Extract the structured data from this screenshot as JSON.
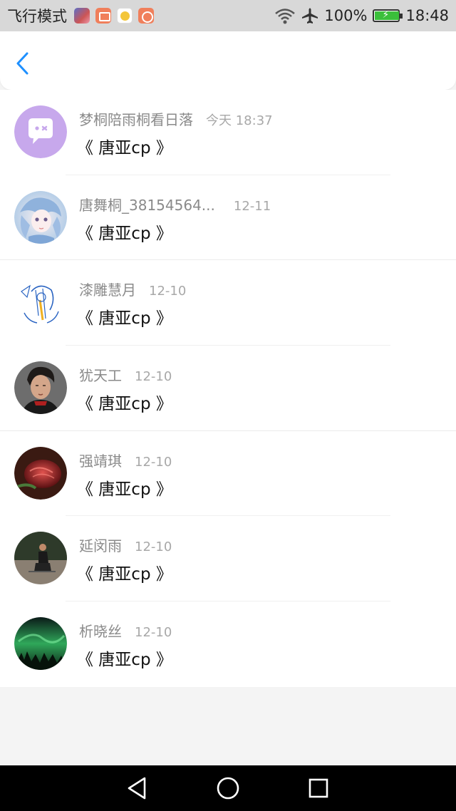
{
  "status_bar": {
    "mode_label": "飞行模式",
    "battery_text": "100%",
    "time": "18:48",
    "icons": [
      "app-icon-1",
      "app-icon-2",
      "app-icon-3",
      "app-icon-4",
      "wifi-icon",
      "airplane-icon",
      "battery-icon"
    ]
  },
  "header": {
    "back_icon": "chevron-left-icon"
  },
  "messages": [
    {
      "name": "梦桐陪雨桐看日落",
      "time": "今天 18:37",
      "message": "《 唐亚cp 》",
      "avatar": "chat-bubble-avatar"
    },
    {
      "name": "唐舞桐_38154564...",
      "time": "12-11",
      "message": "《 唐亚cp 》",
      "avatar": "anime-girl-avatar"
    },
    {
      "name": "漆雕慧月",
      "time": "12-10",
      "message": "《 唐亚cp 》",
      "avatar": "sketch-avatar"
    },
    {
      "name": "犹天工",
      "time": "12-10",
      "message": "《 唐亚cp 》",
      "avatar": "portrait-avatar"
    },
    {
      "name": "强靖琪",
      "time": "12-10",
      "message": "《 唐亚cp 》",
      "avatar": "rose-avatar"
    },
    {
      "name": "延闵雨",
      "time": "12-10",
      "message": "《 唐亚cp 》",
      "avatar": "person-kneeling-avatar"
    },
    {
      "name": "析晓丝",
      "time": "12-10",
      "message": "《 唐亚cp 》",
      "avatar": "aurora-avatar"
    }
  ],
  "nav_bar": {
    "buttons": [
      "back-triangle-icon",
      "home-circle-icon",
      "recents-square-icon"
    ]
  },
  "colors": {
    "accent": "#1e90ff",
    "name_text": "#8a8a8a",
    "time_text": "#a8a8a8"
  }
}
